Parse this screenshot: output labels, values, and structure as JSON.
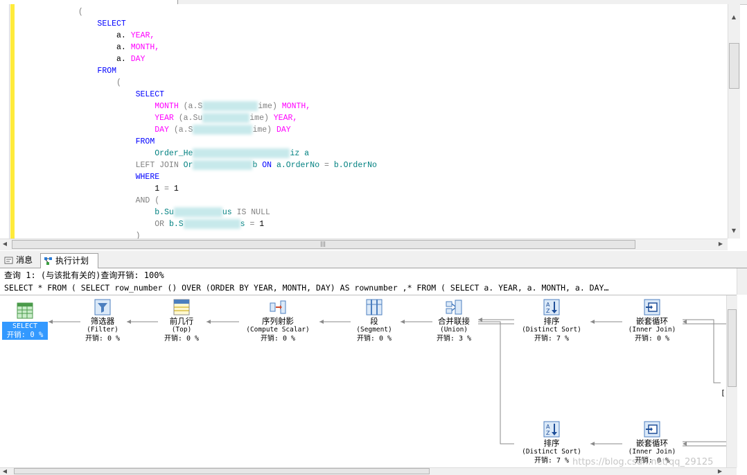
{
  "editor": {
    "lines": [
      [
        {
          "t": "            (",
          "c": "gr"
        }
      ],
      [
        {
          "t": "                SELECT",
          "c": "kw"
        }
      ],
      [
        {
          "t": "                    a. ",
          "c": "bk"
        },
        {
          "t": "YEAR,",
          "c": "fn"
        }
      ],
      [
        {
          "t": "                    a. ",
          "c": "bk"
        },
        {
          "t": "MONTH,",
          "c": "fn"
        }
      ],
      [
        {
          "t": "                    a. ",
          "c": "bk"
        },
        {
          "t": "DAY",
          "c": "fn"
        }
      ],
      [
        {
          "t": "                FROM",
          "c": "kw"
        }
      ],
      [
        {
          "t": "                    (",
          "c": "gr"
        }
      ],
      [
        {
          "t": "                        SELECT",
          "c": "kw"
        }
      ],
      [
        {
          "t": "                            MONTH ",
          "c": "fn"
        },
        {
          "t": "(a.S",
          "c": "gr"
        },
        {
          "blur": 80
        },
        {
          "t": "ime) ",
          "c": "gr"
        },
        {
          "t": "MONTH,",
          "c": "fn"
        }
      ],
      [
        {
          "t": "                            YEAR ",
          "c": "fn"
        },
        {
          "t": "(a.Su",
          "c": "gr"
        },
        {
          "blur": 68
        },
        {
          "t": "ime) ",
          "c": "gr"
        },
        {
          "t": "YEAR,",
          "c": "fn"
        }
      ],
      [
        {
          "t": "                            DAY ",
          "c": "fn"
        },
        {
          "t": "(a.S",
          "c": "gr"
        },
        {
          "blur": 86
        },
        {
          "t": "ime) ",
          "c": "gr"
        },
        {
          "t": "DAY",
          "c": "fn"
        }
      ],
      [
        {
          "t": "                        FROM",
          "c": "kw"
        }
      ],
      [
        {
          "t": "                            Order_He",
          "c": "tx"
        },
        {
          "blur": 140
        },
        {
          "t": "iz a",
          "c": "tx"
        }
      ],
      [
        {
          "t": "                        LEFT JOIN ",
          "c": "gr"
        },
        {
          "t": "Or",
          "c": "tx"
        },
        {
          "blur": 86
        },
        {
          "t": "b ",
          "c": "tx"
        },
        {
          "t": "ON ",
          "c": "kw"
        },
        {
          "t": "a.OrderNo ",
          "c": "tx"
        },
        {
          "t": "= ",
          "c": "gr"
        },
        {
          "t": "b.OrderNo",
          "c": "tx"
        }
      ],
      [
        {
          "t": "                        WHERE",
          "c": "kw"
        }
      ],
      [
        {
          "t": "                            1 ",
          "c": "bk"
        },
        {
          "t": "= ",
          "c": "gr"
        },
        {
          "t": "1",
          "c": "bk"
        }
      ],
      [
        {
          "t": "                        AND (",
          "c": "gr"
        }
      ],
      [
        {
          "t": "                            b.Su",
          "c": "tx"
        },
        {
          "blur": 70
        },
        {
          "t": "us ",
          "c": "tx"
        },
        {
          "t": "IS NULL",
          "c": "gr"
        }
      ],
      [
        {
          "t": "                            OR ",
          "c": "gr"
        },
        {
          "t": "b.S",
          "c": "tx"
        },
        {
          "blur": 82
        },
        {
          "t": "s ",
          "c": "tx"
        },
        {
          "t": "= ",
          "c": "gr"
        },
        {
          "t": "1",
          "c": "bk"
        }
      ],
      [
        {
          "t": "                        )",
          "c": "gr"
        }
      ]
    ]
  },
  "tabs": {
    "messages": "消息",
    "execution_plan": "执行计划"
  },
  "plan": {
    "query_title": "查询 1: (与该批有关的)查询开销: 100%",
    "query_sql": "SELECT * FROM ( SELECT row_number () OVER (ORDER BY YEAR, MONTH, DAY) AS rownumber ,* FROM ( SELECT a. YEAR, a. MONTH, a. DAY…",
    "nodes": {
      "select": {
        "name": "SELECT",
        "cost": "开销: 0 %"
      },
      "filter": {
        "name": "筛选器",
        "op": "(Filter)",
        "cost": "开销: 0 %"
      },
      "top": {
        "name": "前几行",
        "op": "(Top)",
        "cost": "开销: 0 %"
      },
      "compute": {
        "name": "序列射影",
        "op": "(Compute Scalar)",
        "cost": "开销: 0 %"
      },
      "segment": {
        "name": "段",
        "op": "(Segment)",
        "cost": "开销: 0 %"
      },
      "union": {
        "name": "合并联接",
        "op": "(Union)",
        "cost": "开销: 3 %"
      },
      "sort1": {
        "name": "排序",
        "op": "(Distinct Sort)",
        "cost": "开销: 7 %"
      },
      "loop1": {
        "name": "嵌套循环",
        "op": "(Inner Join)",
        "cost": "开销: 0 %"
      },
      "sort2": {
        "name": "排序",
        "op": "(Distinct Sort)",
        "cost": "开销: 7 %"
      },
      "loop2": {
        "name": "嵌套循环",
        "op": "(Inner Join)",
        "cost": "开销: 0 %"
      }
    },
    "right_clip": "[",
    "watermark": "https://blog.csdn.net/qq_29125"
  }
}
